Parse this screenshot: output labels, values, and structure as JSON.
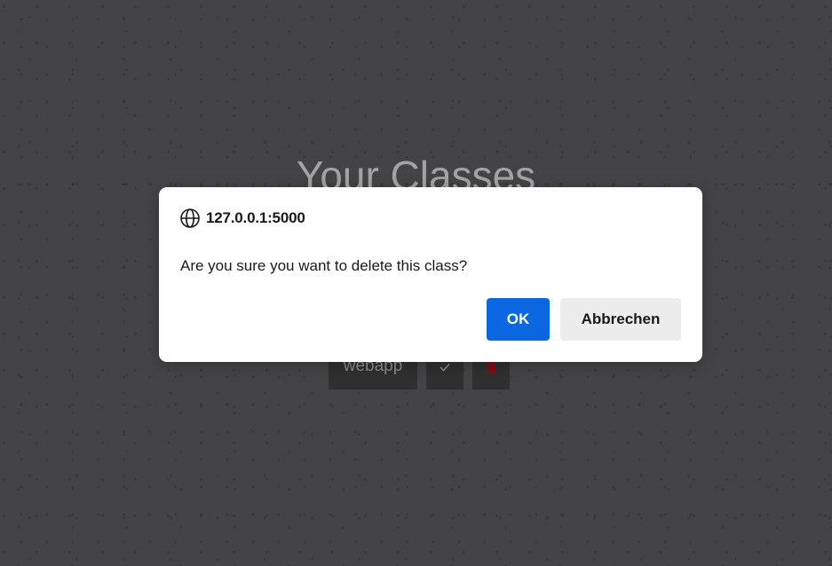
{
  "page": {
    "title": "Your Classes",
    "classes": [
      {
        "name": "webapp",
        "check_icon": "check-icon",
        "delete_icon": "trash-icon"
      }
    ]
  },
  "dialog": {
    "origin": "127.0.0.1:5000",
    "origin_icon": "globe-icon",
    "message": "Are you sure you want to delete this class?",
    "ok_label": "OK",
    "cancel_label": "Abbrechen"
  },
  "colors": {
    "primary_button": "#0b67e0",
    "delete_icon": "#7a1014",
    "background": "#444446"
  }
}
